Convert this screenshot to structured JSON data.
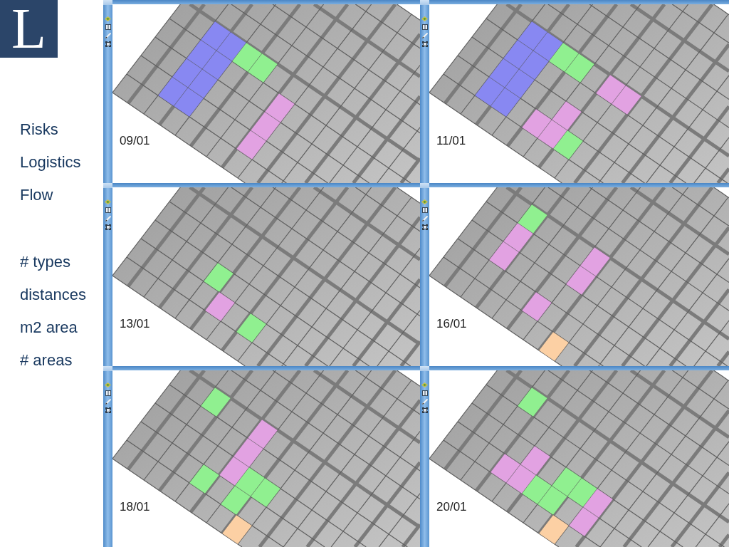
{
  "logo": {
    "letter": "L"
  },
  "sidebar": {
    "groups": [
      {
        "items": [
          "Risks",
          "Logistics",
          "Flow"
        ]
      },
      {
        "items": [
          "# types",
          "distances",
          "m2 area",
          "# areas"
        ]
      }
    ]
  },
  "panels": [
    {
      "date": "09/01",
      "zones": [
        {
          "color": "#8888f2"
        },
        {
          "color": "#90f090"
        },
        {
          "color": "#e2a2e2"
        }
      ]
    },
    {
      "date": "11/01",
      "zones": [
        {
          "color": "#8888f2"
        },
        {
          "color": "#90f090"
        },
        {
          "color": "#e2a2e2"
        },
        {
          "color": "#e2a2e2"
        },
        {
          "color": "#90f090"
        }
      ]
    },
    {
      "date": "13/01",
      "zones": [
        {
          "color": "#90f090"
        },
        {
          "color": "#e2a2e2"
        },
        {
          "color": "#90f090"
        }
      ]
    },
    {
      "date": "16/01",
      "zones": [
        {
          "color": "#90f090"
        },
        {
          "color": "#e2a2e2"
        },
        {
          "color": "#e2a2e2"
        },
        {
          "color": "#e2a2e2"
        },
        {
          "color": "#fcd0a4"
        }
      ]
    },
    {
      "date": "18/01",
      "zones": [
        {
          "color": "#90f090"
        },
        {
          "color": "#e2a2e2"
        },
        {
          "color": "#90f090"
        },
        {
          "color": "#90f090"
        },
        {
          "color": "#fcd0a4"
        }
      ]
    },
    {
      "date": "20/01",
      "zones": [
        {
          "color": "#90f090"
        },
        {
          "color": "#e2a2e2"
        },
        {
          "color": "#90f090"
        },
        {
          "color": "#e2a2e2"
        },
        {
          "color": "#fcd0a4"
        }
      ]
    }
  ]
}
